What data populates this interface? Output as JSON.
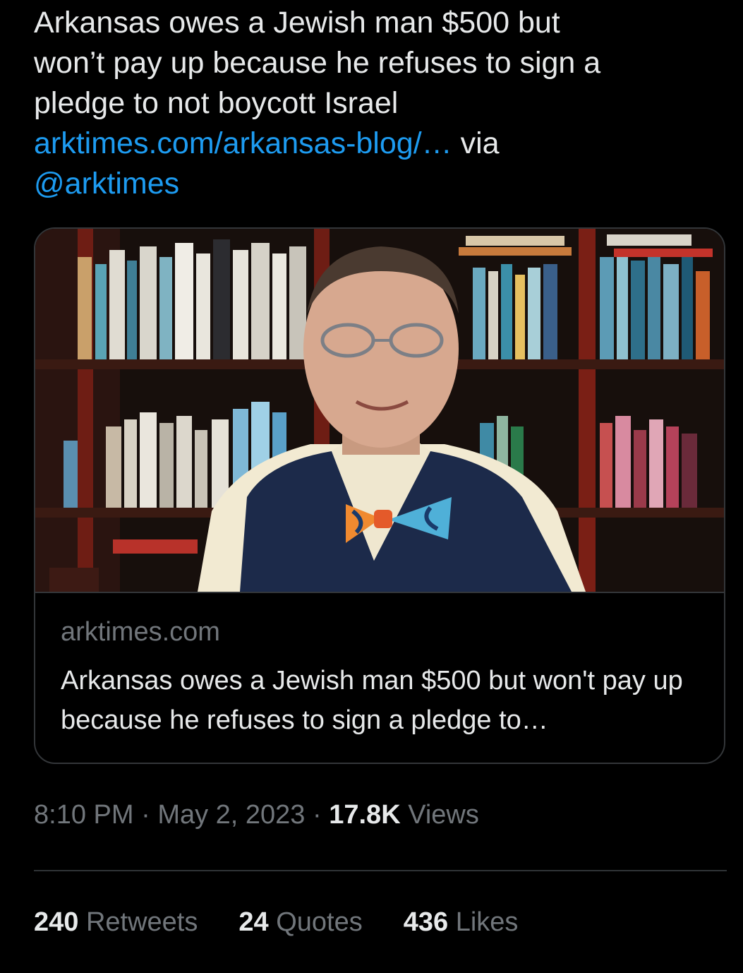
{
  "tweet": {
    "text_line1": "Arkansas owes a Jewish man $500 but",
    "text_line2": "won’t pay up because he refuses to sign a",
    "text_line3": "pledge to not boycott Israel",
    "link_text": "arktimes.com/arkansas-blog/…",
    "via_text": " via",
    "mention": "@arktimes"
  },
  "card": {
    "domain": "arktimes.com",
    "title": "Arkansas owes a Jewish man $500 but won't pay up because he refuses to sign a pledge to…"
  },
  "meta": {
    "time": "8:10 PM",
    "sep1": " · ",
    "date": "May 2, 2023",
    "sep2": " · ",
    "views_count": "17.8K",
    "views_label": " Views"
  },
  "stats": {
    "retweets_count": "240",
    "retweets_label": " Retweets",
    "quotes_count": "24",
    "quotes_label": " Quotes",
    "likes_count": "436",
    "likes_label": " Likes"
  },
  "colors": {
    "background": "#000000",
    "text": "#e7e9ea",
    "muted": "#71767b",
    "link": "#1d9bf0",
    "border": "#333639"
  }
}
